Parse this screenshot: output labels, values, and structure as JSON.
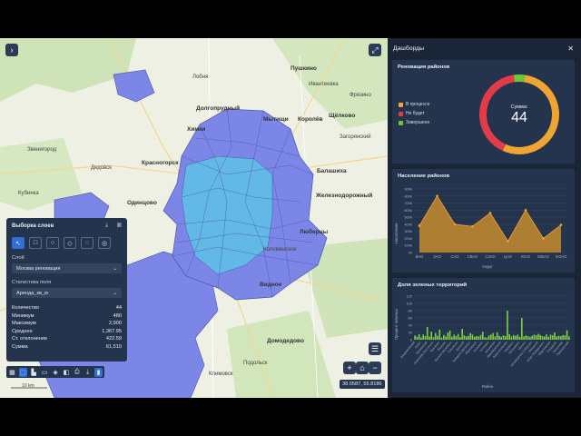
{
  "map": {
    "labels": [
      "Красногорск",
      "Химки",
      "Мытищи",
      "Королёв",
      "Пушкино",
      "Щёлково",
      "Балашиха",
      "Железнодорожный",
      "Люберцы",
      "Одинцово",
      "Видное",
      "Домодедово",
      "Долгопрудный",
      "Лобня",
      "Дедовск",
      "Загорянский",
      "Подольск",
      "Климовск",
      "Коломенское",
      "Кубинка",
      "Звенигород",
      "Ивантеевка",
      "Фрязино"
    ],
    "coordinates": "38.0587, 55.8186",
    "scale_label": "10 km"
  },
  "selection_panel": {
    "title": "Выборка слоев",
    "layer_label": "Слой",
    "layer_value": "Москва реновация",
    "field_label": "Статистика поля",
    "field_value": "Аренда_кв_м",
    "stats": [
      {
        "label": "Количество",
        "value": "44"
      },
      {
        "label": "Минимум",
        "value": "480"
      },
      {
        "label": "Максимум",
        "value": "2,900"
      },
      {
        "label": "Среднее",
        "value": "1,367.95"
      },
      {
        "label": "Ст. отклонение",
        "value": "422.59"
      },
      {
        "label": "Сумма",
        "value": "61,510"
      }
    ]
  },
  "dashboard": {
    "title": "Дашборды",
    "donut": {
      "title": "Реновация районов",
      "center_label": "Сумма:",
      "center_value": "44",
      "legend": [
        {
          "name": "В процессе",
          "color": "#f0a532",
          "value": 24
        },
        {
          "name": "Не будет",
          "color": "#e33b47",
          "value": 18
        },
        {
          "name": "Завершено",
          "color": "#6cc63c",
          "value": 2
        }
      ]
    },
    "population": {
      "title": "Население районов",
      "ylabel": "Население",
      "xlabel": "Округ"
    },
    "green": {
      "title": "Доля зеленых территорий",
      "ylabel": "Процент зеленых",
      "xlabel": "Район"
    }
  },
  "chart_data": [
    {
      "type": "pie",
      "title": "Реновация районов",
      "categories": [
        "В процессе",
        "Не будет",
        "Завершено"
      ],
      "values": [
        24,
        18,
        2
      ]
    },
    {
      "type": "area",
      "title": "Население районов",
      "xlabel": "Округ",
      "ylabel": "Население",
      "categories": [
        "ВАО",
        "ЗАО",
        "САО",
        "СВАО",
        "СЗАО",
        "ЦАО",
        "ЮАО",
        "ЮВАО",
        "ЮЗАО"
      ],
      "values": [
        380000,
        800000,
        400000,
        370000,
        560000,
        160000,
        600000,
        200000,
        390000
      ],
      "ylim": [
        0,
        900000
      ],
      "yticks": [
        "0k",
        "100k",
        "200k",
        "300k",
        "400k",
        "500k",
        "600k",
        "700k",
        "800k",
        "900k"
      ]
    },
    {
      "type": "bar",
      "title": "Доля зеленых территорий",
      "xlabel": "Район",
      "ylabel": "Процент зеленых",
      "ylim": [
        0,
        120
      ],
      "yticks": [
        "0",
        "20",
        "40",
        "60",
        "80",
        "100",
        "120"
      ],
      "categories": [
        "Академический",
        "Алексеевский",
        "Алтуфьевский",
        "Арбат",
        "Аэропорт",
        "Бабушкинский",
        "Басманный",
        "Беговой",
        "Бибирево",
        "Бирюлёво Восточное",
        "Бирюлёво Западное",
        "Богородское",
        "Братеево",
        "Бутырский",
        "Вешняки",
        "Внуково",
        "Войковский",
        "Восточный",
        "Выхино-Жулебино",
        "Гагаринский",
        "Головинский",
        "Гольяново",
        "Даниловский",
        "Дмитровский",
        "Донской",
        "Дорогомилово",
        "Замоскворечье",
        "Западное Дегунино",
        "Зюзино",
        "Зябликово",
        "Ивановское",
        "Измайлово",
        "Капотня",
        "Коньково",
        "Коптево",
        "Косино-Ухтомский",
        "Котловка",
        "Красносельский",
        "Крылатское",
        "Кузьминки",
        "Кунцево",
        "Куркино",
        "Левобережный",
        "Лефортово",
        "Лианозово",
        "Ломоносовский",
        "Лосиноостровский",
        "Люблино",
        "Марфино",
        "Марьина Роща",
        "Марьино",
        "Матушкино",
        "Метрогородок",
        "Мещанский",
        "Митино",
        "Можайский",
        "Молжаниновский",
        "Москворечье-Сабурово",
        "Нагатино-Садовники",
        "Нагатинский Затон",
        "Нагорный",
        "Некрасовка",
        "Нижегородский",
        "Ново-Переделкино",
        "Новогиреево",
        "Новокосино",
        "Обручевский",
        "Орехово-Борисово Северное",
        "Останкинский",
        "Отрадное",
        "Очаково-Матвеевское",
        "Перово",
        "Печатники",
        "Покровское-Стрешнево",
        "Преображенское",
        "Пресненский"
      ],
      "values": [
        12,
        8,
        15,
        6,
        14,
        10,
        35,
        9,
        22,
        7,
        18,
        11,
        28,
        6,
        13,
        9,
        20,
        25,
        8,
        14,
        10,
        16,
        7,
        30,
        12,
        9,
        11,
        18,
        14,
        8,
        10,
        9,
        13,
        22,
        7,
        6,
        12,
        14,
        18,
        9,
        20,
        11,
        8,
        12,
        10,
        80,
        15,
        9,
        13,
        11,
        14,
        8,
        60,
        9,
        12,
        10,
        8,
        11,
        14,
        12,
        16,
        13,
        10,
        9,
        15,
        8,
        14,
        12,
        20,
        9,
        11,
        10,
        13,
        12,
        26,
        9
      ]
    }
  ]
}
